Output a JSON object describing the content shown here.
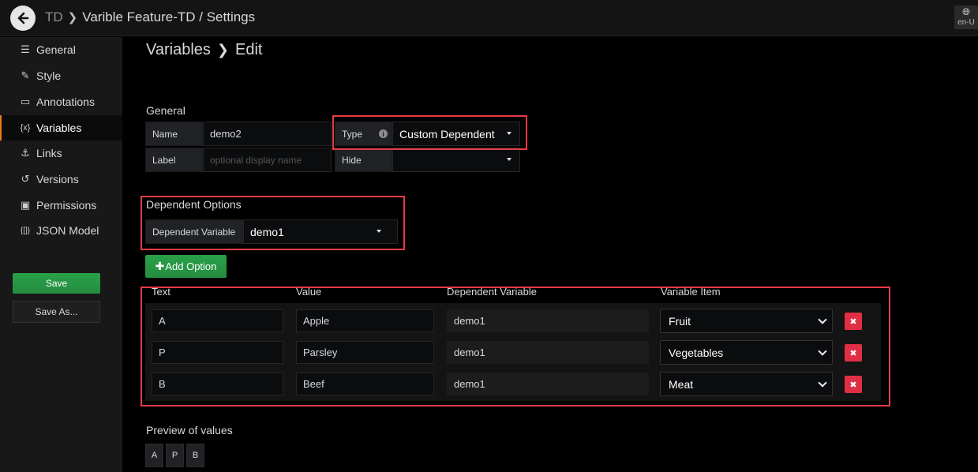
{
  "header": {
    "root": "TD",
    "title": "Varible Feature-TD / Settings",
    "lang": "en-U"
  },
  "sidebar": {
    "items": [
      {
        "label": "General",
        "icon": "sliders-icon"
      },
      {
        "label": "Style",
        "icon": "edit-icon"
      },
      {
        "label": "Annotations",
        "icon": "comment-icon"
      },
      {
        "label": "Variables",
        "icon": "variable-icon",
        "active": true
      },
      {
        "label": "Links",
        "icon": "link-icon"
      },
      {
        "label": "Versions",
        "icon": "history-icon"
      },
      {
        "label": "Permissions",
        "icon": "lock-icon"
      },
      {
        "label": "JSON Model",
        "icon": "json-icon"
      }
    ],
    "save_label": "Save",
    "save_as_label": "Save As..."
  },
  "main": {
    "breadcrumb_parent": "Variables",
    "breadcrumb_current": "Edit",
    "general": {
      "section_label": "General",
      "name_label": "Name",
      "name_value": "demo2",
      "label_label": "Label",
      "label_placeholder": "optional display name",
      "type_label": "Type",
      "type_value": "Custom Dependent",
      "hide_label": "Hide",
      "hide_value": ""
    },
    "dependent": {
      "section_label": "Dependent Options",
      "variable_label": "Dependent Variable",
      "variable_value": "demo1"
    },
    "add_option_label": "Add Option",
    "table": {
      "headers": [
        "Text",
        "Value",
        "Dependent Variable",
        "Variable Item"
      ],
      "rows": [
        {
          "text": "A",
          "value": "Apple",
          "dependent": "demo1",
          "item": "Fruit"
        },
        {
          "text": "P",
          "value": "Parsley",
          "dependent": "demo1",
          "item": "Vegetables"
        },
        {
          "text": "B",
          "value": "Beef",
          "dependent": "demo1",
          "item": "Meat"
        }
      ]
    },
    "preview": {
      "label": "Preview of values",
      "values": [
        "A",
        "P",
        "B"
      ]
    }
  },
  "colors": {
    "accent": "#eb7b18",
    "primary_button": "#299c46",
    "danger": "#e02f44",
    "highlight_box": "#e63b45"
  }
}
